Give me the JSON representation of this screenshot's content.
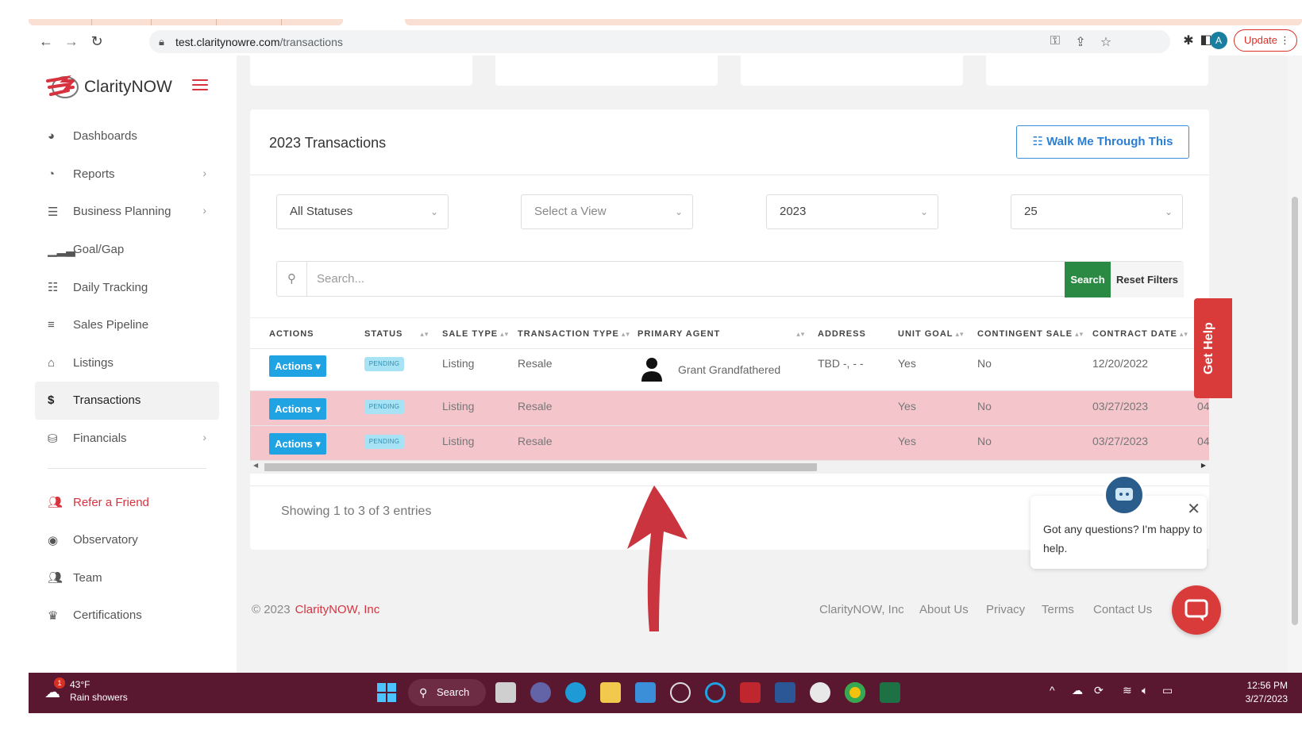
{
  "browser": {
    "url_host": "test.claritynowre.com",
    "url_path": "/transactions",
    "profile_initial": "A",
    "update_label": "Update"
  },
  "sidebar": {
    "brand": "ClarityNOW",
    "items": [
      {
        "label": "Dashboards",
        "icon": "palette-icon"
      },
      {
        "label": "Reports",
        "icon": "pie-chart-icon"
      },
      {
        "label": "Business Planning",
        "icon": "checklist-icon"
      },
      {
        "label": "Goal/Gap",
        "icon": "signal-bars-icon"
      },
      {
        "label": "Daily Tracking",
        "icon": "list-icon"
      },
      {
        "label": "Sales Pipeline",
        "icon": "lines-icon"
      },
      {
        "label": "Listings",
        "icon": "home-icon"
      },
      {
        "label": "Transactions",
        "icon": "dollar-icon"
      },
      {
        "label": "Financials",
        "icon": "coins-icon"
      }
    ],
    "bottom_items": [
      {
        "label": "Refer a Friend",
        "icon": "users-icon"
      },
      {
        "label": "Observatory",
        "icon": "eye-icon"
      },
      {
        "label": "Team",
        "icon": "team-icon"
      },
      {
        "label": "Certifications",
        "icon": "crown-icon"
      }
    ]
  },
  "panel": {
    "title": "2023 Transactions",
    "walk_label": "Walk Me Through This",
    "filters": {
      "status": "All Statuses",
      "view_placeholder": "Select a View",
      "year": "2023",
      "page_size": "25"
    },
    "search_placeholder": "Search...",
    "search_button": "Search",
    "reset_button": "Reset Filters",
    "columns": [
      "ACTIONS",
      "STATUS",
      "SALE TYPE",
      "TRANSACTION TYPE",
      "PRIMARY AGENT",
      "ADDRESS",
      "UNIT GOAL",
      "CONTINGENT SALE",
      "CONTRACT DATE"
    ],
    "rows": [
      {
        "action": "Actions",
        "status": "PENDING",
        "sale_type": "Listing",
        "transaction_type": "Resale",
        "agent": "Grant Grandfathered",
        "address": "TBD -, - -",
        "unit_goal": "Yes",
        "contingent": "No",
        "contract_date": "12/20/2022",
        "overflow": ""
      },
      {
        "action": "Actions",
        "status": "PENDING",
        "sale_type": "Listing",
        "transaction_type": "Resale",
        "agent": "",
        "address": "",
        "unit_goal": "Yes",
        "contingent": "No",
        "contract_date": "03/27/2023",
        "overflow": "04"
      },
      {
        "action": "Actions",
        "status": "PENDING",
        "sale_type": "Listing",
        "transaction_type": "Resale",
        "agent": "",
        "address": "",
        "unit_goal": "Yes",
        "contingent": "No",
        "contract_date": "03/27/2023",
        "overflow": "04"
      }
    ],
    "showing": "Showing 1 to 3 of 3 entries"
  },
  "get_help": "Get Help",
  "chat": {
    "message": "Got any questions? I'm happy to help."
  },
  "footer": {
    "copyright": "© 2023",
    "brand": "ClarityNOW, Inc",
    "links": [
      "ClarityNOW, Inc",
      "About Us",
      "Privacy",
      "Terms",
      "Contact Us"
    ]
  },
  "taskbar": {
    "temp": "43°F",
    "condition": "Rain showers",
    "weather_badge": "1",
    "search_label": "Search",
    "time": "12:56 PM",
    "date": "3/27/2023"
  },
  "colors": {
    "accent": "#d6333f",
    "blue": "#1fa3e3",
    "green": "#2a8a43",
    "row_highlight": "#f4c5cb",
    "taskbar": "#5a1830"
  }
}
